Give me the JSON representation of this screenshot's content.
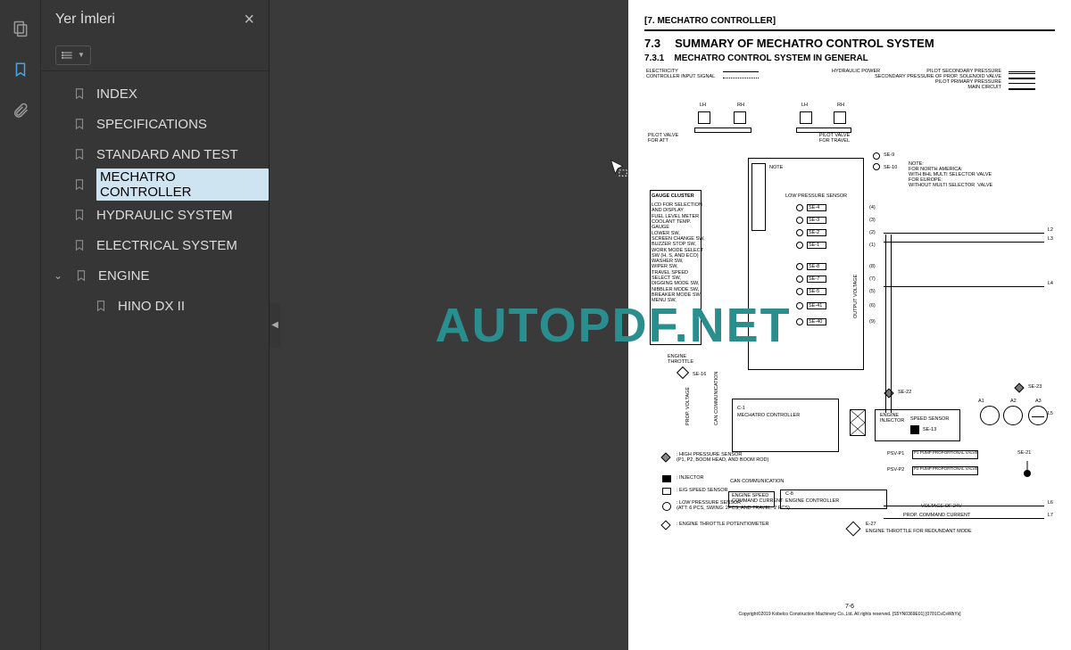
{
  "panel": {
    "title": "Yer İmleri",
    "close_label": "×"
  },
  "toolbar": {
    "dropdown_icon": "list"
  },
  "bookmarks": [
    {
      "label": "INDEX",
      "selected": false,
      "expanded": false,
      "nested": false
    },
    {
      "label": "SPECIFICATIONS",
      "selected": false,
      "expanded": false,
      "nested": false
    },
    {
      "label": "STANDARD AND TEST",
      "selected": false,
      "expanded": false,
      "nested": false
    },
    {
      "label": "MECHATRO CONTROLLER",
      "selected": true,
      "expanded": false,
      "nested": false
    },
    {
      "label": "HYDRAULIC SYSTEM",
      "selected": false,
      "expanded": false,
      "nested": false
    },
    {
      "label": "ELECTRICAL SYSTEM",
      "selected": false,
      "expanded": false,
      "nested": false
    },
    {
      "label": "ENGINE",
      "selected": false,
      "expanded": true,
      "nested": false
    },
    {
      "label": "HINO DX II",
      "selected": false,
      "expanded": false,
      "nested": true
    }
  ],
  "watermark": "AUTOPDF.NET",
  "page": {
    "chapter": "[7.   MECHATRO CONTROLLER]",
    "section_num": "7.3",
    "section_title": "SUMMARY OF MECHATRO CONTROL SYSTEM",
    "subsection_num": "7.3.1",
    "subsection_title": "MECHATRO CONTROL SYSTEM IN GENERAL",
    "page_number": "7-6",
    "copyright": "Copyright©2019 Kobelco Construction Machinery Co.,Ltd. All rights reserved. [S5YN0369E01] [0701CsCsWbYs]",
    "diagram": {
      "top_left_label": "ELECTRICITY\nCONTROLLER INPUT SIGNAL",
      "top_right_label": "HYDRAULIC POWER",
      "top_right_sub": "PILOT SECONDARY PRESSURE\nSECONDARY PRESSURE OF PROP. SOLENOID VALVE\nPILOT PRIMARY PRESSURE\nMAIN CIRCUIT",
      "lh": "LH",
      "rh": "RH",
      "pilot_valve_att": "PILOT VALVE\nFOR ATT",
      "pilot_valve_travel": "PILOT VALVE\nFOR TRAVEL",
      "note_label": "NOTE",
      "note_text": "NOTE:\nFOR NORTH AMERICA:\nWITH BHL MULTI SELECTOR VALVE\nFOR EUROPE:\nWITHOUT MULTI SELECTOR  VALVE",
      "gauge_cluster": "GAUGE CLUSTER",
      "gauge_cluster_desc": "LCD FOR SELECTION\nAND DISPLAY\nFUEL LEVEL METER\nCOOLANT TEMP.\nGAUGE\nLOWER SW,\nSCREEN CHANGE SW,\nBUZZER STOP SW,\nWORK MODE SELECT\nSW (H, S, AND ECO)\nWASHER SW,\nWIPER SW,\nTRAVEL SPEED\nSELECT SW,\nDIGGING MODE SW,\nNIBBLER MODE SW,\nBREAKER MODE SW,\nMENU SW,",
      "low_pressure_sensor": "LOW PRESSURE SENSOR",
      "sensors": [
        "SE-9",
        "SE-10",
        "SE-4",
        "SE-3",
        "SE-2",
        "SE-1",
        "SE-8",
        "SE-7",
        "SE-5",
        "SE-41",
        "SE-40"
      ],
      "sensor_nums": [
        "(4)",
        "(3)",
        "(2)",
        "(1)",
        "(8)",
        "(7)",
        "(5)",
        "(6)",
        "(9)"
      ],
      "output_voltage": "OUTPUT VOLTAGE",
      "engine_throttle": "ENGINE\nTHROTTLE",
      "se16": "SE-16",
      "prop_voltage": "PROP. VOLTAGE",
      "can_communication": "CAN COMMUNICATION",
      "c1": "C-1",
      "mechatro_controller": "MECHATRO CONTROLLER",
      "engine_injector": "ENGINE\nINJECTOR",
      "speed_sensor": "SPEED SENSOR",
      "se13": "SE-13",
      "se22": "SE-22",
      "se23": "SE-23",
      "se21": "SE-21",
      "a1": "A1",
      "a2": "A2",
      "a3": "A3",
      "psv_p1": "PSV-P1",
      "psv_p1_label": "P1 PUMP PROPORTIONAL VALVE",
      "psv_p2": "PSV-P2",
      "psv_p2_label": "P2 PUMP PROPORTIONAL VALVE",
      "c8": "C-8",
      "engine_controller": "ENGINE CONTROLLER",
      "engine_speed_cmd": "ENGINE SPEED\nCOMMAND CURRENT",
      "voltage_24v": "VOLTAGE OF 24V",
      "prop_cmd_current": "PROP. COMMAND CURRENT",
      "e27": "E-27",
      "engine_throttle_redundant": "ENGINE THROTTLE FOR REDUNDANT MODE",
      "lines": [
        "L2",
        "L3",
        "L4",
        "L5",
        "L6",
        "L7"
      ],
      "legend": {
        "high_pressure": ": HIGH PRESSURE SENSOR\n(P1, P2, BOOM HEAD, AND BOOM ROD)",
        "injector": ": INJECTOR",
        "eg_speed": ": E/G  SPEED SENSOR",
        "low_pressure": ": LOW PRESSURE SENSOR\n(ATT: 6 PCS, SWING: 2PCS, AND TRAVEL: 2 PCS)",
        "throttle_pot": ": ENGINE THROTTLE POTENTIOMETER"
      }
    }
  }
}
